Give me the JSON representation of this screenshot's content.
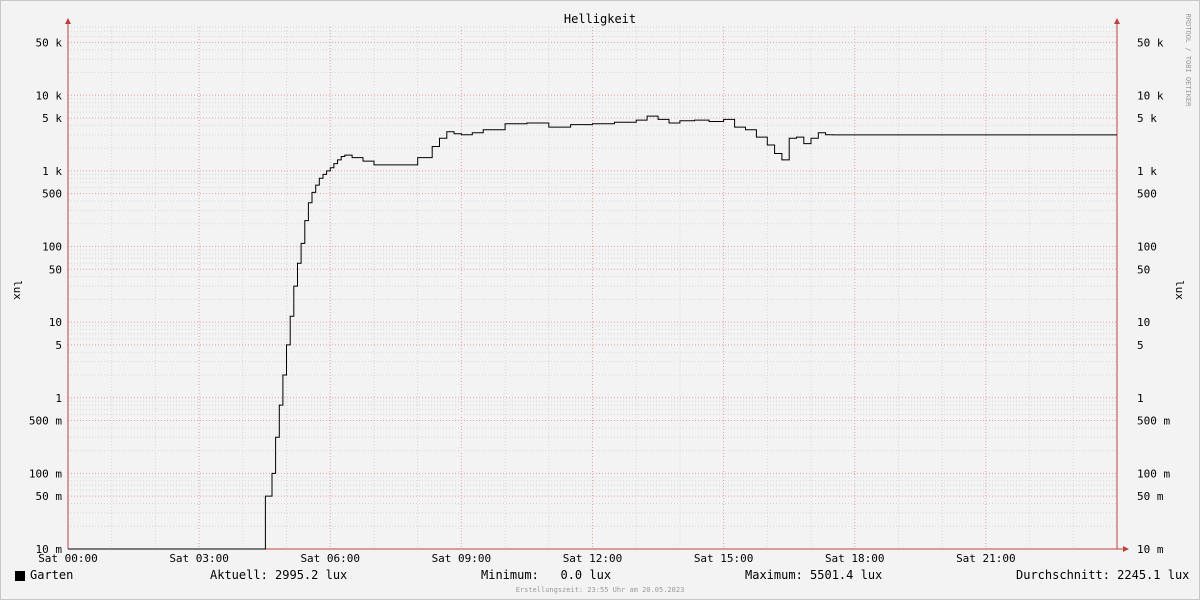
{
  "chart_data": {
    "type": "line",
    "title": "Helligkeit",
    "ylabel": "lux",
    "yscale": "log",
    "ylim": [
      0.01,
      80000
    ],
    "x_tick_labels": [
      "Sat 00:00",
      "Sat 03:00",
      "Sat 06:00",
      "Sat 09:00",
      "Sat 12:00",
      "Sat 15:00",
      "Sat 18:00",
      "Sat 21:00"
    ],
    "y_ticks": [
      {
        "value": 0.01,
        "label": "10 m"
      },
      {
        "value": 0.05,
        "label": "50 m"
      },
      {
        "value": 0.1,
        "label": "100 m"
      },
      {
        "value": 0.5,
        "label": "500 m"
      },
      {
        "value": 1,
        "label": "1"
      },
      {
        "value": 5,
        "label": "5"
      },
      {
        "value": 10,
        "label": "10"
      },
      {
        "value": 50,
        "label": "50"
      },
      {
        "value": 100,
        "label": "100"
      },
      {
        "value": 500,
        "label": "500"
      },
      {
        "value": 1000,
        "label": "1 k"
      },
      {
        "value": 5000,
        "label": "5 k"
      },
      {
        "value": 10000,
        "label": "10 k"
      },
      {
        "value": 50000,
        "label": "50 k"
      }
    ],
    "grid": true,
    "series": [
      {
        "name": "Garten",
        "color": "#000000",
        "x": [
          "00:00",
          "04:30",
          "04:31",
          "04:40",
          "04:45",
          "04:50",
          "04:55",
          "05:00",
          "05:05",
          "05:10",
          "05:15",
          "05:20",
          "05:25",
          "05:30",
          "05:35",
          "05:40",
          "05:45",
          "05:50",
          "05:55",
          "06:00",
          "06:05",
          "06:10",
          "06:15",
          "06:20",
          "06:30",
          "06:45",
          "07:00",
          "07:30",
          "08:00",
          "08:20",
          "08:30",
          "08:40",
          "08:50",
          "09:00",
          "09:15",
          "09:30",
          "10:00",
          "10:30",
          "11:00",
          "11:30",
          "12:00",
          "12:30",
          "13:00",
          "13:15",
          "13:30",
          "13:45",
          "14:00",
          "14:20",
          "14:40",
          "15:00",
          "15:15",
          "15:30",
          "15:45",
          "16:00",
          "16:10",
          "16:20",
          "16:30",
          "16:40",
          "16:50",
          "17:00",
          "17:10",
          "17:20",
          "17:30",
          "17:40",
          "24:00"
        ],
        "y": [
          0.01,
          0.01,
          0.05,
          0.1,
          0.3,
          0.8,
          2,
          5,
          12,
          30,
          60,
          110,
          220,
          380,
          520,
          650,
          800,
          900,
          1000,
          1100,
          1250,
          1400,
          1550,
          1620,
          1500,
          1350,
          1200,
          1200,
          1500,
          2100,
          2700,
          3300,
          3100,
          3000,
          3200,
          3500,
          4200,
          4300,
          3800,
          4100,
          4200,
          4400,
          4700,
          5300,
          4800,
          4300,
          4600,
          4700,
          4500,
          4800,
          3800,
          3500,
          2800,
          2200,
          1700,
          1400,
          2700,
          2800,
          2300,
          2700,
          3200,
          3000,
          2995,
          2995,
          2995
        ]
      }
    ],
    "legend": {
      "placement": "bottom",
      "entries": [
        {
          "label": "Garten",
          "color": "#000000"
        }
      ]
    }
  },
  "stats": {
    "current": "Aktuell: 2995.2 lux",
    "minimum": "Minimum:   0.0 lux",
    "maximum": "Maximum: 5501.4 lux",
    "average": "Durchschnitt: 2245.1 lux"
  },
  "footer": "Erstellungszeit: 23:55 Uhr am 20.05.2023",
  "watermark": "RRDTOOL / TOBI OETIKER",
  "colors": {
    "major_grid": "#e8a0a0",
    "minor_grid": "#d8d8d8",
    "axis": "#c04040"
  }
}
